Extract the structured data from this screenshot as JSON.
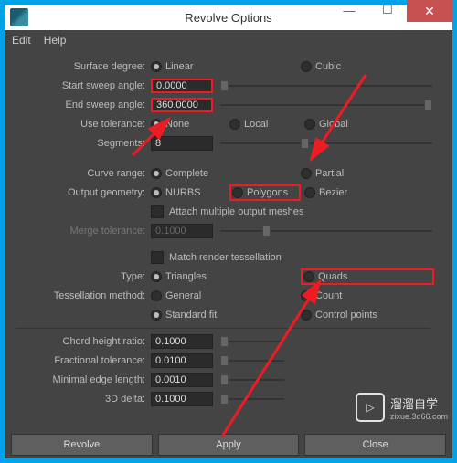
{
  "window": {
    "title": "Revolve Options"
  },
  "menu": {
    "edit": "Edit",
    "help": "Help"
  },
  "labels": {
    "surfaceDegree": "Surface degree:",
    "startSweep": "Start sweep angle:",
    "endSweep": "End sweep angle:",
    "useTolerance": "Use tolerance:",
    "segments": "Segments:",
    "curveRange": "Curve range:",
    "outputGeometry": "Output geometry:",
    "attachMeshes": "Attach multiple output meshes",
    "mergeTolerance": "Merge tolerance:",
    "matchTess": "Match render tessellation",
    "type": "Type:",
    "tessMethod": "Tessellation method:",
    "chordHeight": "Chord height ratio:",
    "fracTol": "Fractional tolerance:",
    "minEdge": "Minimal edge length:",
    "delta3d": "3D delta:"
  },
  "radios": {
    "linear": "Linear",
    "cubic": "Cubic",
    "none": "None",
    "local": "Local",
    "global": "Global",
    "complete": "Complete",
    "partial": "Partial",
    "nurbs": "NURBS",
    "polygons": "Polygons",
    "bezier": "Bezier",
    "triangles": "Triangles",
    "quads": "Quads",
    "general": "General",
    "count": "Count",
    "standardFit": "Standard fit",
    "controlPoints": "Control points"
  },
  "values": {
    "startSweep": "0.0000",
    "endSweep": "360.0000",
    "segments": "8",
    "mergeTol": "0.1000",
    "chord": "0.1000",
    "frac": "0.0100",
    "minEdge": "0.0010",
    "delta": "0.1000"
  },
  "buttons": {
    "revolve": "Revolve",
    "apply": "Apply",
    "close": "Close"
  },
  "watermark": {
    "brand": "溜溜自学",
    "url": "zixue.3d66.com"
  }
}
